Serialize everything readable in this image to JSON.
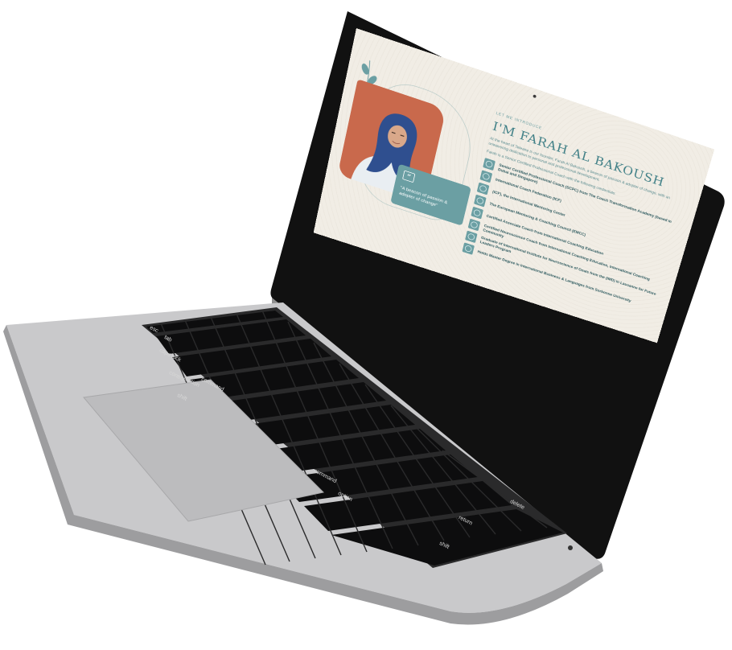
{
  "site": {
    "eyebrow": "LET ME INTRODUCE",
    "title": "I'M FARAH AL BAKOUSH",
    "intro": "At the heart of Teleaire is our founder, Farah Al Bakoush, a beacon of passion & adopter of change, with an unwavering dedication to personal and professional development.",
    "credentials_intro": "Farah is a Senior Certified Professional Coach with the following credentials:",
    "quote": "\"A beacon of passion & adopter of change\"",
    "quote_icon": "quote-mark-icon",
    "credentials": [
      "Senior Certified Professional Coach (SCPC) from The Coach Transformation Academy (based in Dubai and Singapore)",
      "International Coach Federation (ICF)",
      "(ICF), the International Mentoring Center",
      "The European Mentoring & Coaching Council (EMCC)",
      "Certified Associate Coach from International Coaching Education",
      "Certified Neuroscience Coach from International Coaching Education, International Coaching Community",
      "Graduate of International Institute for Neuroscience of Goals from the (IMD) in Lausanne for Future Leaders Program",
      "Holds Master Degree in International Business & Languages from Sorbonne University"
    ],
    "colors": {
      "background": "#f1ede5",
      "teal": "#6b9fa3",
      "terracotta": "#c9694c",
      "hijab": "#2f4f8f"
    }
  },
  "keyboard": {
    "labels": [
      "esc",
      "caps lock",
      "control",
      "option",
      "command",
      "command",
      "option",
      "shift",
      "return",
      "delete",
      "tab",
      "shift"
    ]
  }
}
